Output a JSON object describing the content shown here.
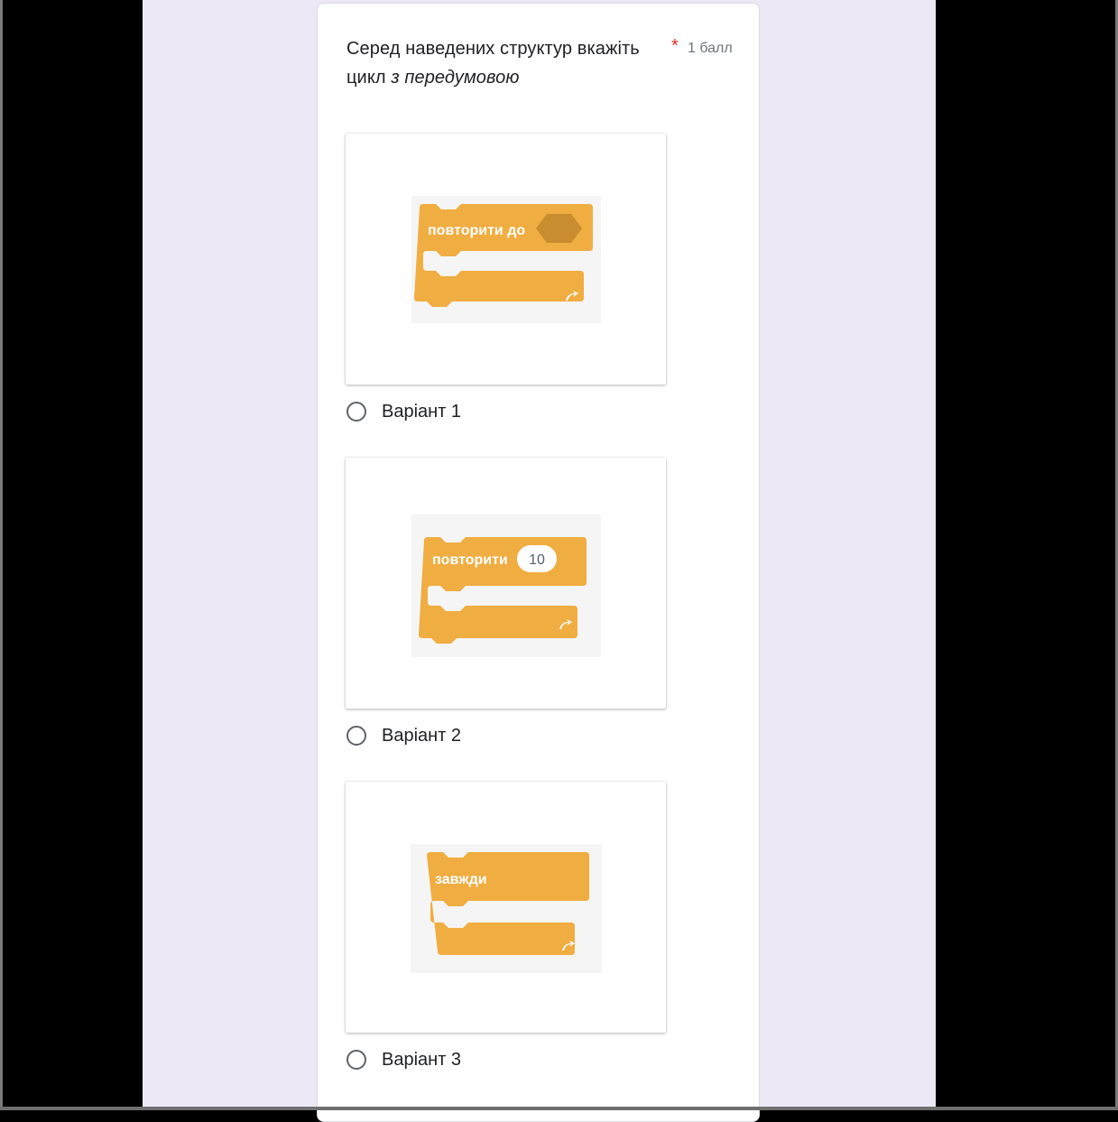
{
  "question": {
    "text_part1": "Серед наведених структур вкажіть цикл ",
    "text_emphasis": "з передумовою",
    "required_mark": "*",
    "points": "1 балл"
  },
  "options": [
    {
      "label": "Варіант 1",
      "block_text": "повторити до",
      "block_type": "repeat-until"
    },
    {
      "label": "Варіант 2",
      "block_text": "повторити",
      "block_value": "10",
      "block_type": "repeat-count"
    },
    {
      "label": "Варіант 3",
      "block_text": "завжди",
      "block_type": "forever"
    }
  ],
  "colors": {
    "block_orange": "#f0ad41",
    "block_dark": "#c88d2e",
    "page_background": "#ede8f5",
    "required_red": "#d93025"
  }
}
